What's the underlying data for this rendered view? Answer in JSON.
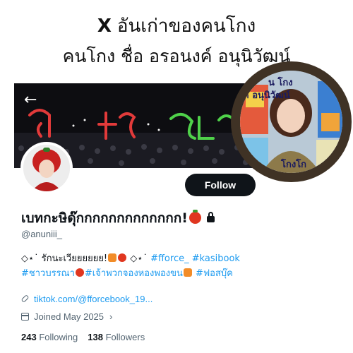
{
  "headline": {
    "x_logo": "X",
    "line1": "อันเก่าของคนโกง",
    "line2": "คนโกง ชื่อ อรอนงค์ อนุนิวัฒน์"
  },
  "profile": {
    "back_icon": "arrow-left-icon",
    "follow_label": "Follow",
    "display_name": "เบทกะษิดุ๊กกกกกกกกกกกกก!",
    "lock_icon": "lock-icon",
    "handle": "@anuniii_",
    "bio_line1_prefix": "◇⋆˙ รักนะเวียยยยยย!",
    "bio_line1_mid": "◇⋆˙",
    "bio_tag1": "#fforce_",
    "bio_tag2": "#kasibook",
    "bio_tag3": "#ชาวบรรณา",
    "bio_tag4": "#เจ้าพวกจองหองพองขน",
    "bio_tag5": "#ฟอสบุ๊ค",
    "link_icon": "link-icon",
    "link_text": "tiktok.com/@fforcebook_19...",
    "calendar_icon": "calendar-icon",
    "joined_text": "Joined May 2025",
    "joined_chevron": "›",
    "following_count": "243",
    "following_label": "Following",
    "followers_count": "138",
    "followers_label": "Followers"
  },
  "inset": {
    "caption_top": "น โกง",
    "caption_mid": "ค์ อนุนิวัฒน์",
    "caption_bottom": "โกงโก"
  },
  "colors": {
    "accent_link": "#1d9bf0",
    "follow_button": "#0f1419",
    "frame": "#3f3225"
  }
}
